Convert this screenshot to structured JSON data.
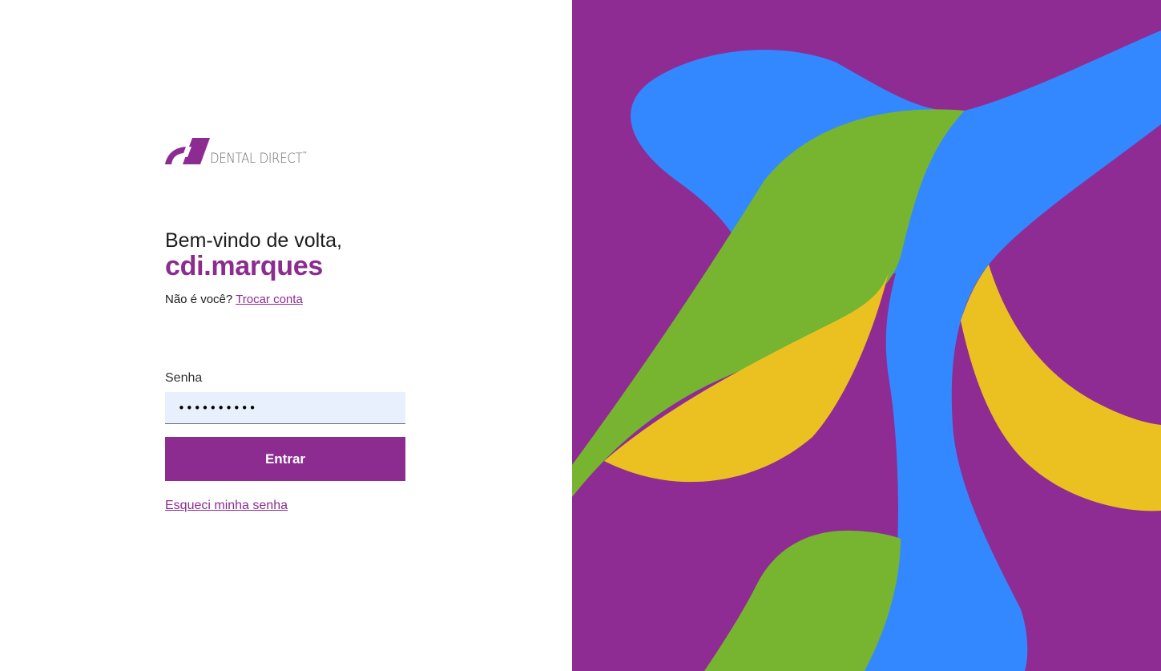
{
  "brand": {
    "name": "DENTAL DIRECT",
    "trademark": "™"
  },
  "login": {
    "welcome": "Bem-vindo de volta,",
    "username": "cdi.marques",
    "not_you": "Não é você?",
    "switch_account": "Trocar conta",
    "password_label": "Senha",
    "password_value": "••••••••••",
    "submit_label": "Entrar",
    "forgot_password": "Esqueci minha senha"
  },
  "colors": {
    "brand_purple": "#8c2c91",
    "input_background": "#e8f0fe",
    "art_purple": "#8e2c93",
    "art_blue": "#3388ff",
    "art_green": "#77b530",
    "art_yellow": "#ebc122"
  }
}
